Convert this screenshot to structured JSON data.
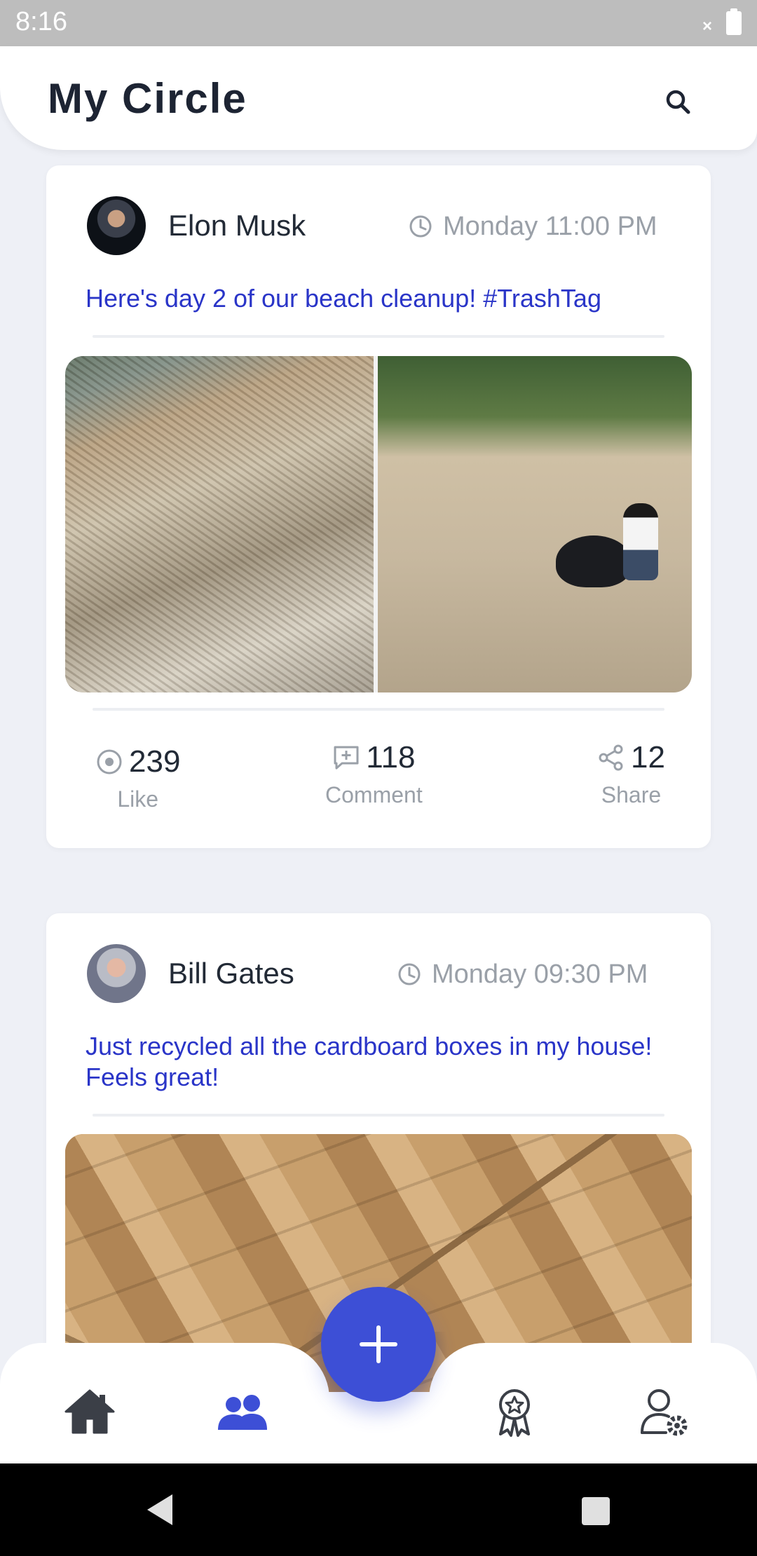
{
  "status_bar": {
    "time": "8:16",
    "signal_glyph": "×"
  },
  "header": {
    "title": "My Circle",
    "search_icon": "search-icon"
  },
  "posts": [
    {
      "author": "Elon Musk",
      "timestamp": "Monday 11:00 PM",
      "text": "Here's day 2 of our beach cleanup! #TrashTag",
      "stats": {
        "like": {
          "value": "239",
          "label": "Like"
        },
        "comment": {
          "value": "118",
          "label": "Comment"
        },
        "share": {
          "value": "12",
          "label": "Share"
        }
      }
    },
    {
      "author": "Bill Gates",
      "timestamp": "Monday 09:30 PM",
      "text": "Just recycled all the cardboard boxes in my house! Feels great!"
    }
  ],
  "bottom_nav": {
    "items": [
      "home-icon",
      "circle-icon",
      "awards-icon",
      "profile-settings-icon"
    ],
    "active": "circle-icon"
  },
  "colors": {
    "accent": "#3d4fd6",
    "post_text": "#2a35c8",
    "muted": "#9aa0a8",
    "background": "#eef0f6"
  }
}
